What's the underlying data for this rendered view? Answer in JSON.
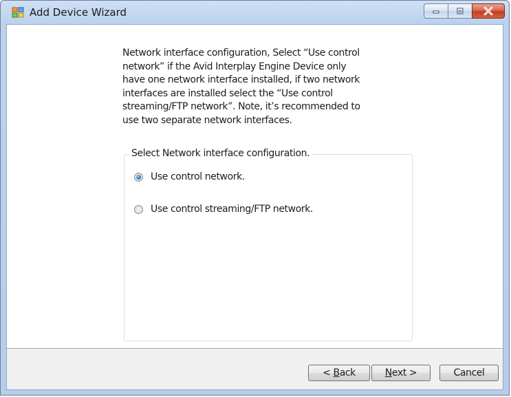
{
  "window": {
    "title": "Add Device Wizard",
    "icon": "wizard-app-icon",
    "controls": {
      "minimize_icon": "minimize-icon",
      "maximize_icon": "maximize-icon",
      "close_icon": "close-icon"
    }
  },
  "description": {
    "lines": [
      "Network interface configuration, Select “Use control",
      "network” if the Avid Interplay Engine Device only",
      "have one network interface installed, if  two network",
      "interfaces are installed select the “Use control",
      "streaming/FTP network”. Note, it’s recommended to",
      "use two separate network interfaces."
    ]
  },
  "group": {
    "legend": "Select Network interface configuration.",
    "options": [
      {
        "label": "Use control network.",
        "checked": true
      },
      {
        "label": "Use control streaming/FTP network.",
        "checked": false
      }
    ]
  },
  "buttons": {
    "back": {
      "prefix": "< ",
      "mnemonic": "B",
      "rest": "ack"
    },
    "next": {
      "mnemonic": "N",
      "rest": "ext >"
    },
    "cancel": "Cancel"
  },
  "colors": {
    "radio_checked": "#1b6cb8",
    "close_button": "#c03e1f"
  }
}
